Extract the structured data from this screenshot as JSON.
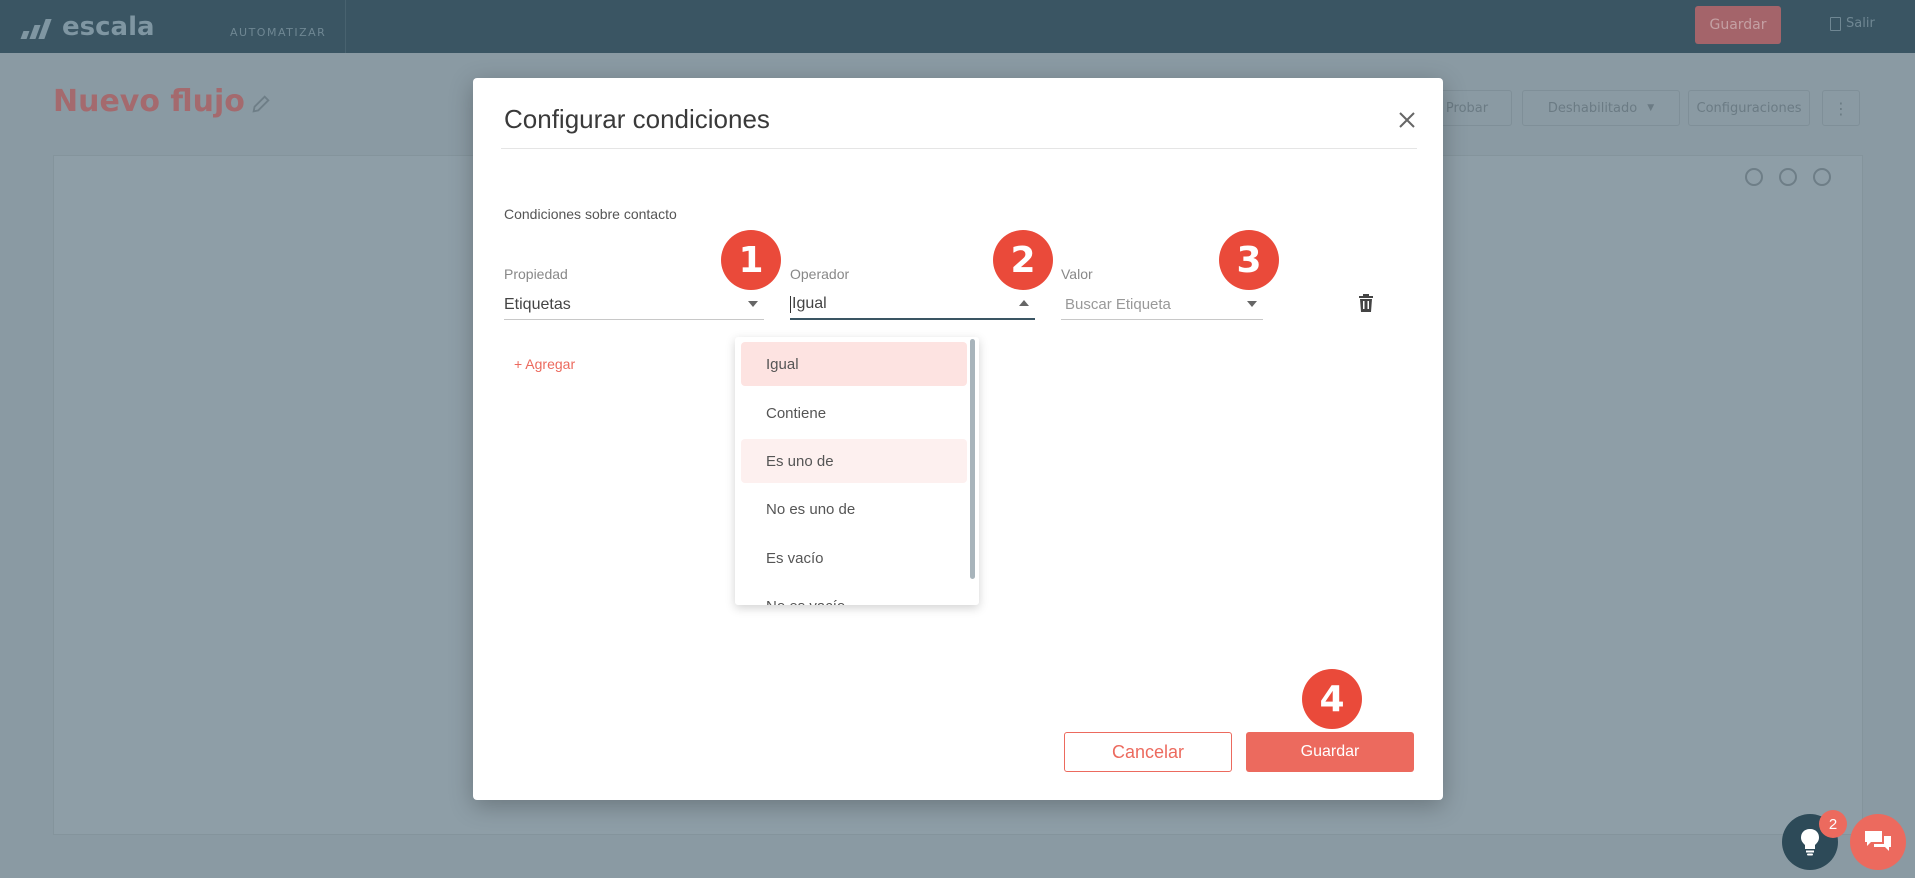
{
  "app": {
    "brand": "escala",
    "nav_link": "AUTOMATIZAR",
    "top_save": "Guardar",
    "top_exit": "Salir"
  },
  "page": {
    "title": "Nuevo flujo",
    "buttons": [
      "Probar",
      "Deshabilitado",
      "Configuraciones"
    ]
  },
  "modal": {
    "title": "Configurar condiciones",
    "section_label": "Condiciones sobre contacto",
    "property": {
      "label": "Propiedad",
      "value": "Etiquetas"
    },
    "operator": {
      "label": "Operador",
      "value": "Igual"
    },
    "value": {
      "label": "Valor",
      "placeholder": "Buscar Etiqueta"
    },
    "add_label": "+ Agregar",
    "operator_options": [
      "Igual",
      "Contiene",
      "Es uno de",
      "No es uno de",
      "Es vacío",
      "No es vacío"
    ],
    "cancel_label": "Cancelar",
    "save_label": "Guardar"
  },
  "callouts": [
    "1",
    "2",
    "3",
    "4"
  ],
  "widgets": {
    "badge_count": "2"
  },
  "colors": {
    "accent": "#ec6a5e",
    "callout": "#ea4a3a",
    "topbar": "#3a5563",
    "overlay": "#8a9aa3"
  }
}
